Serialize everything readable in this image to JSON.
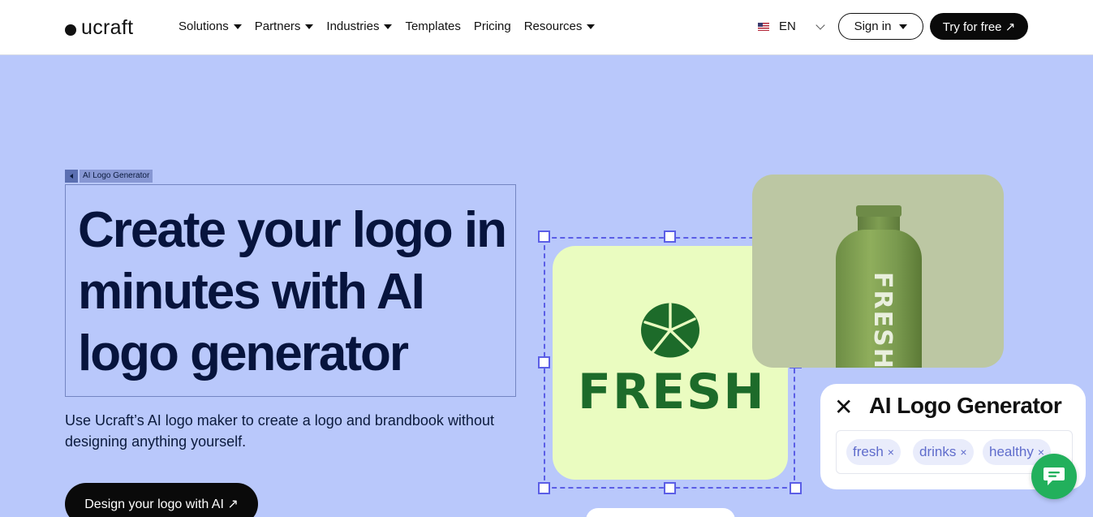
{
  "header": {
    "logo_text": "ucraft",
    "nav": [
      {
        "label": "Solutions",
        "has_dropdown": true
      },
      {
        "label": "Partners",
        "has_dropdown": true
      },
      {
        "label": "Industries",
        "has_dropdown": true
      },
      {
        "label": "Templates",
        "has_dropdown": false
      },
      {
        "label": "Pricing",
        "has_dropdown": false
      },
      {
        "label": "Resources",
        "has_dropdown": true
      }
    ],
    "language": "EN",
    "sign_in_label": "Sign in",
    "try_free_label": "Try for free ↗"
  },
  "hero": {
    "breadcrumb": "AI Logo Generator",
    "title": "Create your logo in minutes with AI logo generator",
    "subtitle": "Use Ucraft’s AI logo maker to create a logo and brandbook without designing anything yourself.",
    "cta_label": "Design your logo with AI ↗"
  },
  "visual": {
    "logo_word": "FRESH",
    "bottle_text": "FRESH",
    "generator_title": "AI Logo Generator",
    "close_symbol": "✕",
    "tags": [
      "fresh",
      "drinks",
      "healthy"
    ],
    "tag_remove_symbol": "×"
  },
  "colors": {
    "hero_bg": "#b9c8fb",
    "title": "#07143d",
    "fresh_green": "#1d6b2a",
    "fresh_card_bg": "#eafcc0",
    "selection": "#5b5ee6",
    "chat": "#22b05c"
  },
  "icons": {
    "chat": "chat-bubble-icon",
    "close": "close-icon",
    "flag": "us-flag-icon",
    "breadcrumb_back": "triangle-left-icon"
  }
}
